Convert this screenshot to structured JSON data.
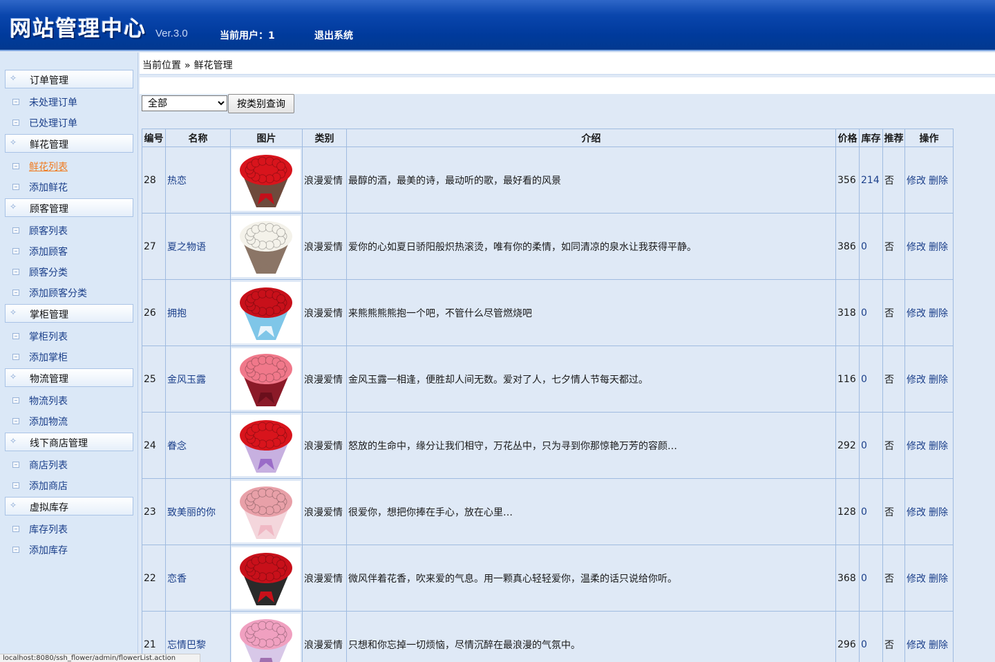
{
  "header": {
    "title": "网站管理中心",
    "version": "Ver.3.0",
    "current_user": "当前用户：1",
    "logout": "退出系统"
  },
  "sidebar": {
    "groups": [
      {
        "label": "订单管理",
        "items": [
          "未处理订单",
          "已处理订单"
        ]
      },
      {
        "label": "鲜花管理",
        "items": [
          "鲜花列表",
          "添加鲜花"
        ]
      },
      {
        "label": "顾客管理",
        "items": [
          "顾客列表",
          "添加顾客",
          "顾客分类",
          "添加顾客分类"
        ]
      },
      {
        "label": "掌柜管理",
        "items": [
          "掌柜列表",
          "添加掌柜"
        ]
      },
      {
        "label": "物流管理",
        "items": [
          "物流列表",
          "添加物流"
        ]
      },
      {
        "label": "线下商店管理",
        "items": [
          "商店列表",
          "添加商店"
        ]
      },
      {
        "label": "虚拟库存",
        "items": [
          "库存列表",
          "添加库存"
        ]
      }
    ],
    "active_item": "鲜花列表"
  },
  "breadcrumb": {
    "prefix": "当前位置",
    "sep": "»",
    "current": "鲜花管理"
  },
  "filter": {
    "selected": "全部",
    "button": "按类别查询"
  },
  "table": {
    "columns": [
      "编号",
      "名称",
      "图片",
      "类别",
      "介绍",
      "价格",
      "库存",
      "推荐",
      "操作"
    ],
    "edit_label": "修改",
    "delete_label": "删除",
    "rows": [
      {
        "id": "28",
        "name": "热恋",
        "category": "浪漫爱情",
        "desc": "最醇的酒，最美的诗，最动听的歌，最好看的风景",
        "price": "356",
        "stock": "214",
        "recommend": "否",
        "flower": "#d8141c",
        "wrap": "#6e4a3c",
        "ribbon": "#c40f1a"
      },
      {
        "id": "27",
        "name": "夏之物语",
        "category": "浪漫爱情",
        "desc": "爱你的心如夏日骄阳般炽热滚烫，唯有你的柔情，如同清凉的泉水让我获得平静。",
        "price": "386",
        "stock": "0",
        "recommend": "否",
        "flower": "#f4f2ea",
        "wrap": "#8b7566",
        "ribbon": "#8b7566"
      },
      {
        "id": "26",
        "name": "拥抱",
        "category": "浪漫爱情",
        "desc": "来熊熊熊熊抱一个吧，不管什么尽管燃烧吧",
        "price": "318",
        "stock": "0",
        "recommend": "否",
        "flower": "#c8101a",
        "wrap": "#7fc6e8",
        "ribbon": "#e9f4fb"
      },
      {
        "id": "25",
        "name": "金风玉露",
        "category": "浪漫爱情",
        "desc": "金风玉露一相逢，便胜却人间无数。爱对了人，七夕情人节每天都过。",
        "price": "116",
        "stock": "0",
        "recommend": "否",
        "flower": "#f0788a",
        "wrap": "#8b1a28",
        "ribbon": "#6b0f1c"
      },
      {
        "id": "24",
        "name": "眷念",
        "category": "浪漫爱情",
        "desc": "怒放的生命中，缘分让我们相守，万花丛中，只为寻到你那惊艳万芳的容颜…",
        "price": "292",
        "stock": "0",
        "recommend": "否",
        "flower": "#d8141c",
        "wrap": "#c7b0e0",
        "ribbon": "#9a6cc8"
      },
      {
        "id": "23",
        "name": "致美丽的你",
        "category": "浪漫爱情",
        "desc": "很爱你，想把你捧在手心，放在心里…",
        "price": "128",
        "stock": "0",
        "recommend": "否",
        "flower": "#e8a0a8",
        "wrap": "#f4d6dc",
        "ribbon": "#f0b8c4"
      },
      {
        "id": "22",
        "name": "恋香",
        "category": "浪漫爱情",
        "desc": "微风伴着花香，吹来爱的气息。用一颗真心轻轻爱你，温柔的话只说给你听。",
        "price": "368",
        "stock": "0",
        "recommend": "否",
        "flower": "#c8101a",
        "wrap": "#2a2a2a",
        "ribbon": "#c8101a"
      },
      {
        "id": "21",
        "name": "忘情巴黎",
        "category": "浪漫爱情",
        "desc": "只想和你忘掉一切烦恼，尽情沉醉在最浪漫的气氛中。",
        "price": "296",
        "stock": "0",
        "recommend": "否",
        "flower": "#f0a0c0",
        "wrap": "#d8c8e8",
        "ribbon": "#a070b0"
      }
    ]
  },
  "status_url": "localhost:8080/ssh_flower/admin/flowerList.action"
}
